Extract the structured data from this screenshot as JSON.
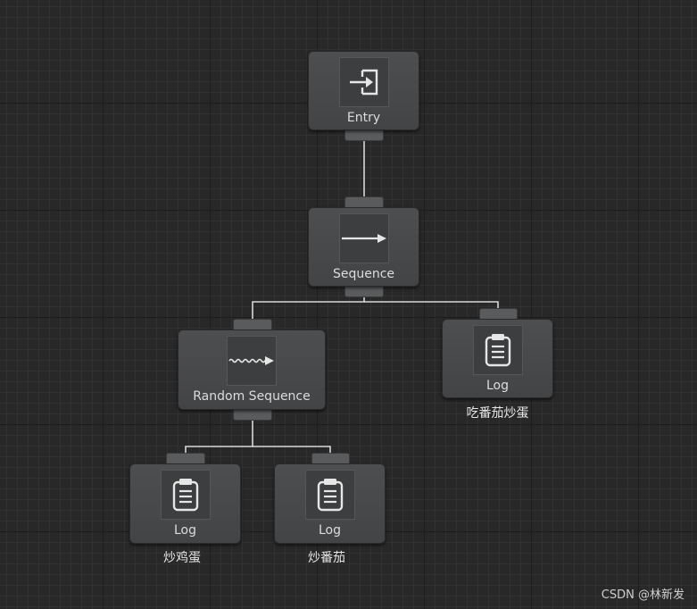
{
  "canvas": {
    "background": "#282828",
    "wire_color": "#d8d8d8"
  },
  "nodes": {
    "entry": {
      "title": "Entry",
      "icon": "entry-icon"
    },
    "sequence": {
      "title": "Sequence",
      "icon": "arrow-right-icon"
    },
    "random_sequence": {
      "title": "Random Sequence",
      "icon": "wavy-arrow-icon"
    },
    "log_eat": {
      "title": "Log",
      "icon": "notepad-icon",
      "comment": "吃番茄炒蛋"
    },
    "log_chicken": {
      "title": "Log",
      "icon": "notepad-icon",
      "comment": "炒鸡蛋"
    },
    "log_tomato": {
      "title": "Log",
      "icon": "notepad-icon",
      "comment": "炒番茄"
    }
  },
  "watermark": "CSDN @林新发"
}
